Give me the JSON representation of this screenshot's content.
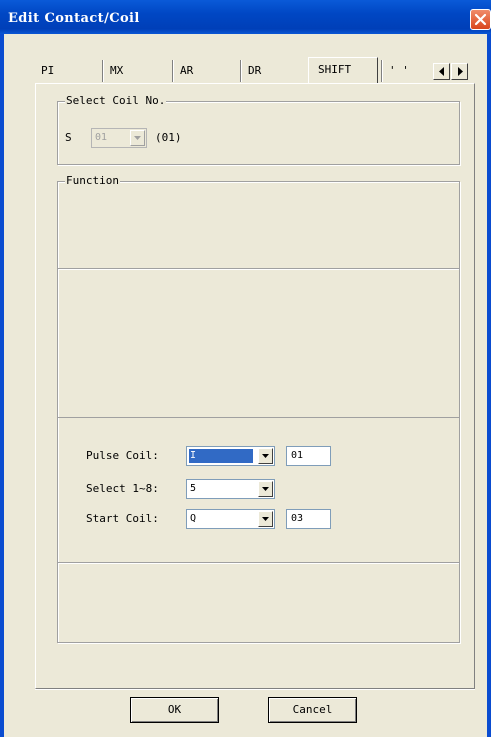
{
  "window": {
    "title": "Edit Contact/Coil",
    "close_icon": "close-icon"
  },
  "tabs": [
    {
      "label": "PI"
    },
    {
      "label": "MX"
    },
    {
      "label": "AR"
    },
    {
      "label": "DR"
    },
    {
      "label": "SHIFT",
      "selected": true
    },
    {
      "label": "' '"
    }
  ],
  "tab_scroll": {
    "left_icon": "triangle-left-icon",
    "right_icon": "triangle-right-icon"
  },
  "select_coil": {
    "title": "Select Coil No.",
    "prefix": "S",
    "value": "01",
    "display": "(01)"
  },
  "function": {
    "title": "Function"
  },
  "pulse_coil": {
    "label": "Pulse Coil:",
    "type_value": "I",
    "number_value": "01"
  },
  "select_1_8": {
    "label": "Select 1~8:",
    "value": "5"
  },
  "start_coil": {
    "label": "Start Coil:",
    "type_value": "Q",
    "number_value": "03"
  },
  "buttons": {
    "ok": "OK",
    "cancel": "Cancel"
  }
}
